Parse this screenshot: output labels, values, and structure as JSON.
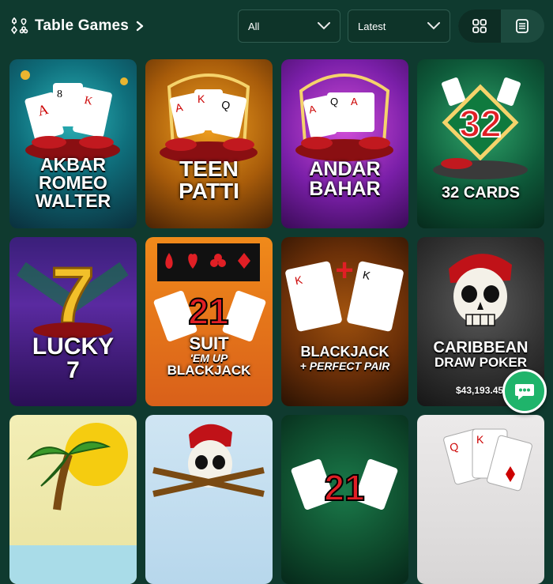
{
  "header": {
    "title": "Table Games",
    "filter_all": "All",
    "sort_latest": "Latest"
  },
  "games": [
    {
      "title_lines": [
        "AKBAR",
        "ROMEO",
        "WALTER"
      ]
    },
    {
      "title_lines": [
        "TEEN",
        "PATTI"
      ]
    },
    {
      "title_lines": [
        "ANDAR",
        "BAHAR"
      ]
    },
    {
      "title_lines": [
        "32 CARDS"
      ],
      "badge": "32"
    },
    {
      "title_lines": [
        "LUCKY",
        "7"
      ],
      "badge": "7"
    },
    {
      "title_lines": [
        "SUIT",
        "'EM UP",
        "BLACKJACK"
      ],
      "badge": "21"
    },
    {
      "title_lines": [
        "BLACKJACK",
        "+ PERFECT PAIR"
      ]
    },
    {
      "title_lines": [
        "CARIBBEAN",
        "DRAW POKER"
      ],
      "jackpot": "$43,193.45"
    },
    {
      "title_lines": []
    },
    {
      "title_lines": []
    },
    {
      "title_lines": [],
      "badge": "21"
    },
    {
      "title_lines": []
    }
  ],
  "colors": {
    "background": "#0f3a2f",
    "chat_green": "#1fb46b"
  }
}
